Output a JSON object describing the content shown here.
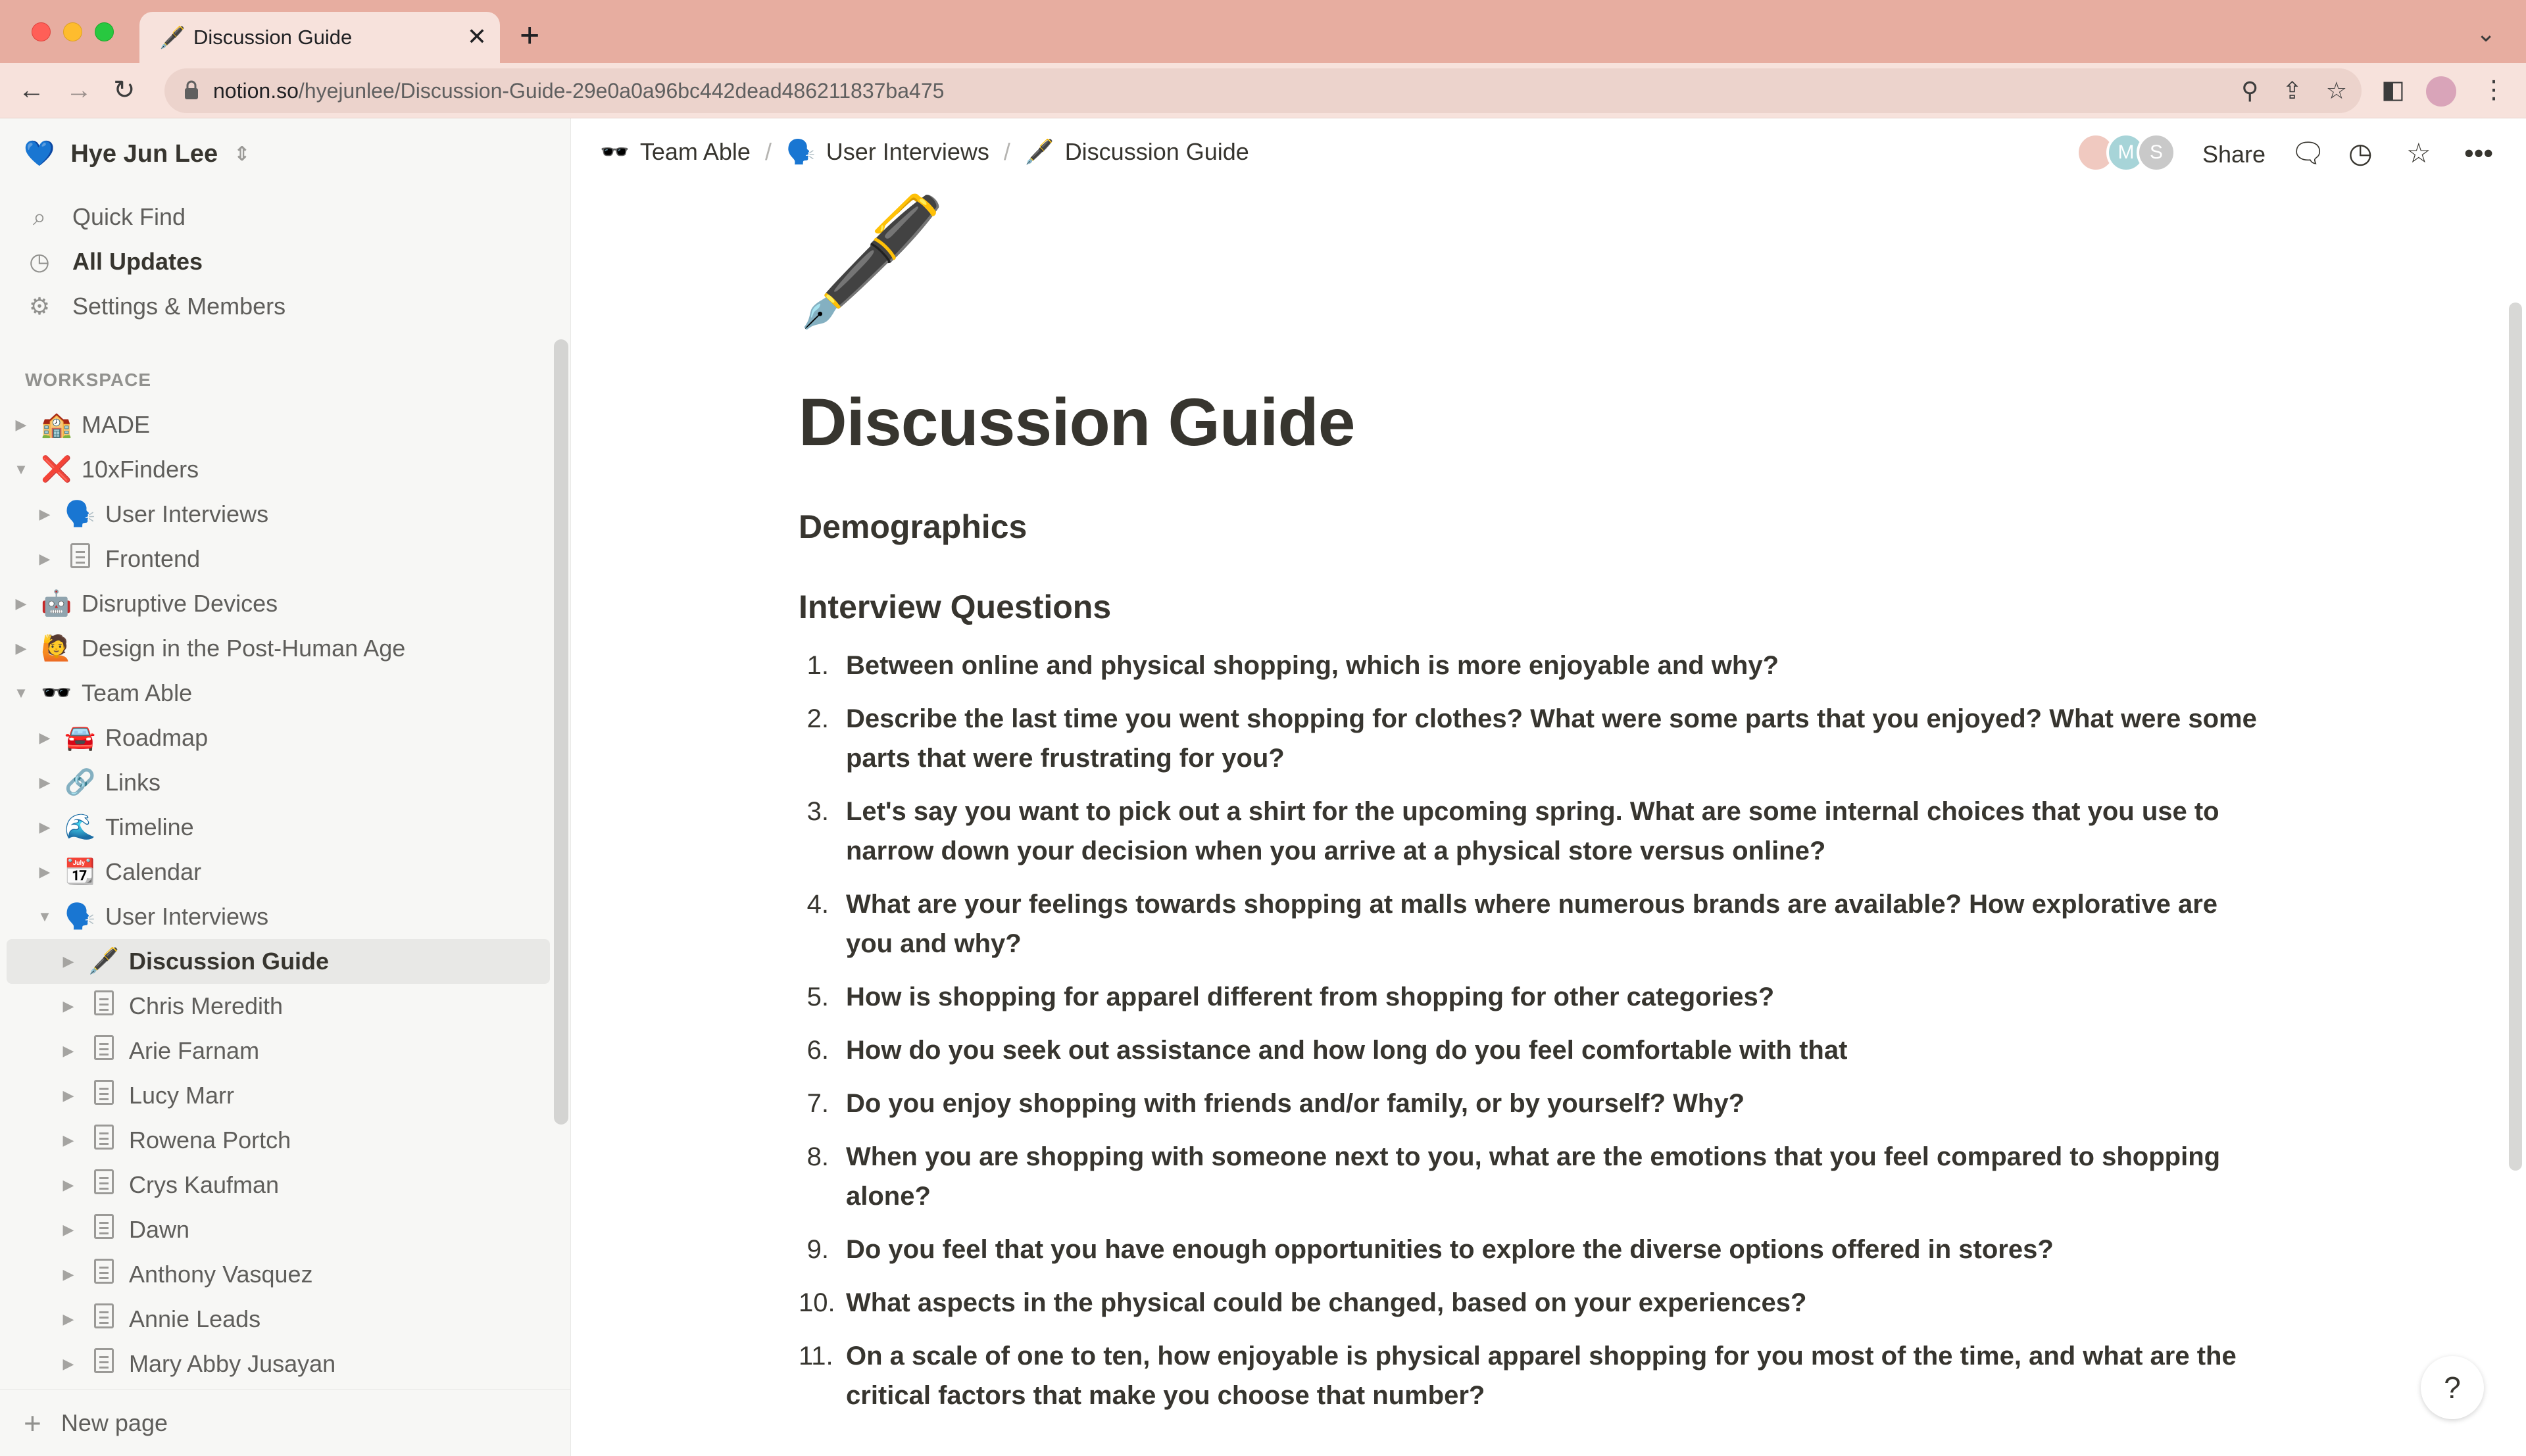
{
  "browser": {
    "tab_title": "Discussion Guide",
    "tab_icon": "🖋️",
    "tab_close": "✕",
    "new_tab": "+",
    "url_host": "notion.so",
    "url_path": "/hyejunlee/Discussion-Guide-29e0a0a96bc442dead486211837ba475"
  },
  "sidebar": {
    "workspace_icon": "💙",
    "workspace_name": "Hye Jun Lee",
    "quick_find": "Quick Find",
    "all_updates": "All Updates",
    "settings": "Settings & Members",
    "section_label": "WORKSPACE",
    "items": [
      {
        "label": "MADE",
        "icon": "🏫",
        "expanded": false,
        "level": 0
      },
      {
        "label": "10xFinders",
        "icon": "❌",
        "expanded": true,
        "level": 0
      },
      {
        "label": "User Interviews",
        "icon": "🗣️",
        "expanded": false,
        "level": 1
      },
      {
        "label": "Frontend",
        "icon": "page-icon",
        "expanded": false,
        "level": 1
      },
      {
        "label": "Disruptive Devices",
        "icon": "🤖",
        "expanded": false,
        "level": 0
      },
      {
        "label": "Design in the Post-Human Age",
        "icon": "🙋",
        "expanded": false,
        "level": 0
      },
      {
        "label": "Team Able",
        "icon": "🕶️",
        "expanded": true,
        "level": 0
      },
      {
        "label": "Roadmap",
        "icon": "🚘",
        "expanded": false,
        "level": 1
      },
      {
        "label": "Links",
        "icon": "🔗",
        "expanded": false,
        "level": 1
      },
      {
        "label": "Timeline",
        "icon": "🌊",
        "expanded": false,
        "level": 1
      },
      {
        "label": "Calendar",
        "icon": "📆",
        "expanded": false,
        "level": 1
      },
      {
        "label": "User Interviews",
        "icon": "🗣️",
        "expanded": true,
        "level": 1
      },
      {
        "label": "Discussion Guide",
        "icon": "🖋️",
        "expanded": false,
        "level": 2,
        "selected": true
      },
      {
        "label": "Chris Meredith",
        "icon": "page-icon",
        "expanded": false,
        "level": 2
      },
      {
        "label": "Arie Farnam",
        "icon": "page-icon",
        "expanded": false,
        "level": 2
      },
      {
        "label": "Lucy Marr",
        "icon": "page-icon",
        "expanded": false,
        "level": 2
      },
      {
        "label": "Rowena Portch",
        "icon": "page-icon",
        "expanded": false,
        "level": 2
      },
      {
        "label": "Crys Kaufman",
        "icon": "page-icon",
        "expanded": false,
        "level": 2
      },
      {
        "label": "Dawn",
        "icon": "page-icon",
        "expanded": false,
        "level": 2
      },
      {
        "label": "Anthony Vasquez",
        "icon": "page-icon",
        "expanded": false,
        "level": 2
      },
      {
        "label": "Annie Leads",
        "icon": "page-icon",
        "expanded": false,
        "level": 2
      },
      {
        "label": "Mary Abby Jusayan",
        "icon": "page-icon",
        "expanded": false,
        "level": 2
      }
    ],
    "new_page": "New page"
  },
  "topbar": {
    "breadcrumbs": [
      {
        "icon": "🕶️",
        "label": "Team Able"
      },
      {
        "icon": "🗣️",
        "label": "User Interviews"
      },
      {
        "icon": "🖋️",
        "label": "Discussion Guide"
      }
    ],
    "separator": "/",
    "avatars": [
      "",
      "M",
      "S"
    ],
    "share": "Share"
  },
  "page": {
    "icon": "🖋️",
    "title": "Discussion Guide",
    "heading_demographics": "Demographics",
    "heading_questions": "Interview Questions",
    "questions": [
      "Between online and physical shopping, which is more enjoyable and why?",
      "Describe the last time you went shopping for clothes? What were some parts that you enjoyed? What were some parts that were frustrating for you?",
      "Let's say you want to pick out a shirt for the upcoming spring. What are some internal choices that you use to narrow down your decision when you arrive at a physical store versus online?",
      "What are your feelings towards shopping at malls where numerous brands are available? How explorative are you and why?",
      "How is shopping for apparel different from shopping for other categories?",
      "How do you seek out assistance and how long do you feel comfortable with that",
      "Do you enjoy shopping with friends and/or family, or by yourself? Why?",
      "When you are shopping with someone next to you, what are the emotions that you feel compared to shopping alone?",
      "Do you feel that you have enough opportunities to explore the diverse options offered in stores?",
      "What aspects in the physical could be changed, based on your experiences?",
      "On a scale of one to ten, how enjoyable is physical apparel shopping for you most of the time, and what are the critical factors that make you choose that number?"
    ]
  },
  "help": "?"
}
